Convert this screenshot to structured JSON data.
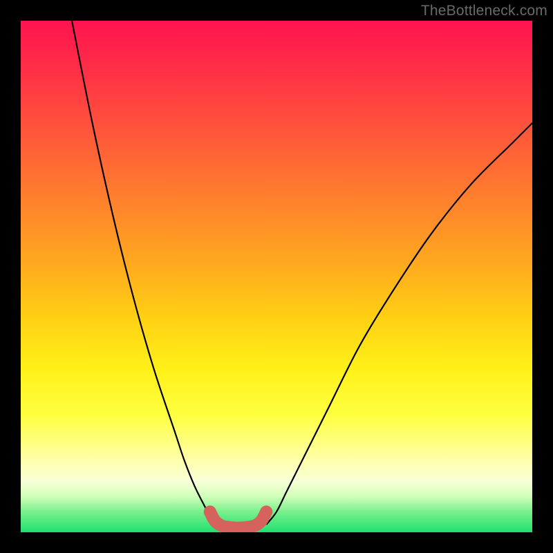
{
  "watermark": "TheBottleneck.com",
  "chart_data": {
    "type": "line",
    "title": "",
    "xlabel": "",
    "ylabel": "",
    "xlim": [
      0,
      100
    ],
    "ylim": [
      0,
      100
    ],
    "grid": false,
    "legend": false,
    "series": [
      {
        "name": "left-branch",
        "x": [
          10,
          14,
          18,
          22,
          26,
          30,
          32,
          34,
          36,
          37,
          38
        ],
        "values": [
          100,
          80,
          62,
          46,
          32,
          20,
          14,
          9,
          5,
          3,
          1.5
        ]
      },
      {
        "name": "right-branch",
        "x": [
          48,
          50,
          52,
          56,
          60,
          66,
          72,
          80,
          88,
          96,
          100
        ],
        "values": [
          1.5,
          4,
          8,
          16,
          24,
          36,
          46,
          58,
          68,
          76,
          80
        ]
      },
      {
        "name": "valley-markers",
        "type": "scatter",
        "x": [
          37,
          38,
          39.5,
          41.5,
          43.5,
          45.5,
          47,
          48
        ],
        "values": [
          4.0,
          2.2,
          1.2,
          0.9,
          0.9,
          1.2,
          2.2,
          4.0
        ]
      }
    ],
    "marker_color": "#d6625d",
    "curve_color": "#000000",
    "background_gradient": [
      "#ff1450",
      "#ffab1e",
      "#ffff40",
      "#20e070"
    ]
  }
}
